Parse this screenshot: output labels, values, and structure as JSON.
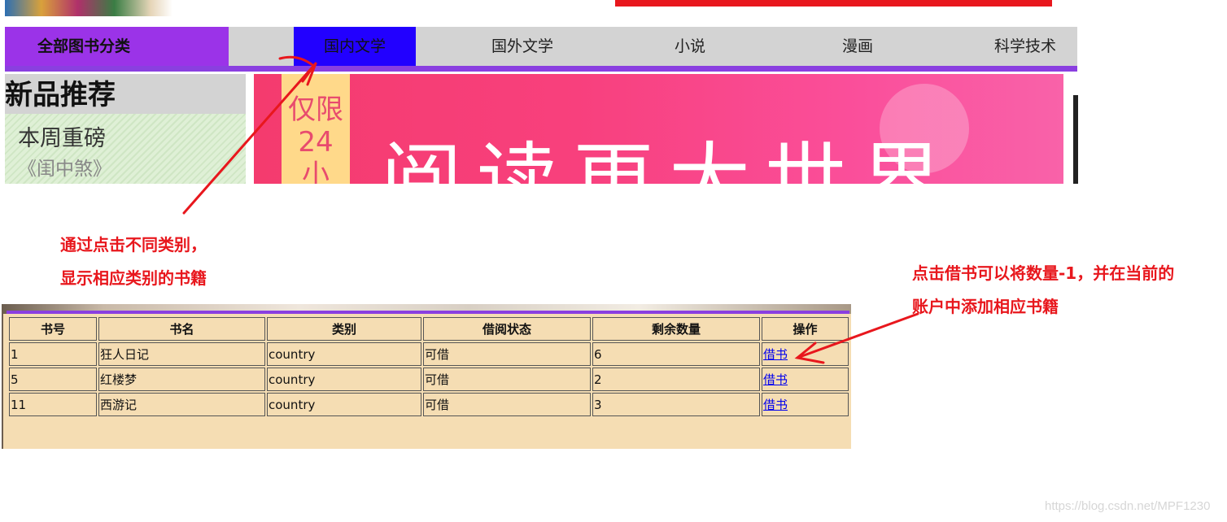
{
  "nav": {
    "all_categories": "全部图书分类",
    "items": [
      "国内文学",
      "国外文学",
      "小说",
      "漫画",
      "科学技术"
    ],
    "active_index": 0
  },
  "new_books": {
    "title": "新品推荐",
    "week_label": "本周重磅",
    "book": "《闺中煞》"
  },
  "banner": {
    "ribbon_text": [
      "仅限",
      "24",
      "小"
    ],
    "headline": "阅读更大世界"
  },
  "annotations": {
    "left_line1": "通过点击不同类别，",
    "left_line2": "显示相应类别的书籍",
    "right_line1": "点击借书可以将数量-1，并在当前的",
    "right_line2": "账户中添加相应书籍"
  },
  "table": {
    "headers": [
      "书号",
      "书名",
      "类别",
      "借阅状态",
      "剩余数量",
      "操作"
    ],
    "rows": [
      [
        "1",
        "狂人日记",
        "country",
        "可借",
        "6",
        "借书"
      ],
      [
        "5",
        "红楼梦",
        "country",
        "可借",
        "2",
        "借书"
      ],
      [
        "11",
        "西游记",
        "country",
        "可借",
        "3",
        "借书"
      ]
    ]
  },
  "watermark": "https://blog.csdn.net/MPF1230",
  "colors": {
    "nav_active": "#2200ff",
    "category_button": "#9b33e8",
    "annotation_red": "#e8171d",
    "table_bg": "#f5ddb3"
  }
}
